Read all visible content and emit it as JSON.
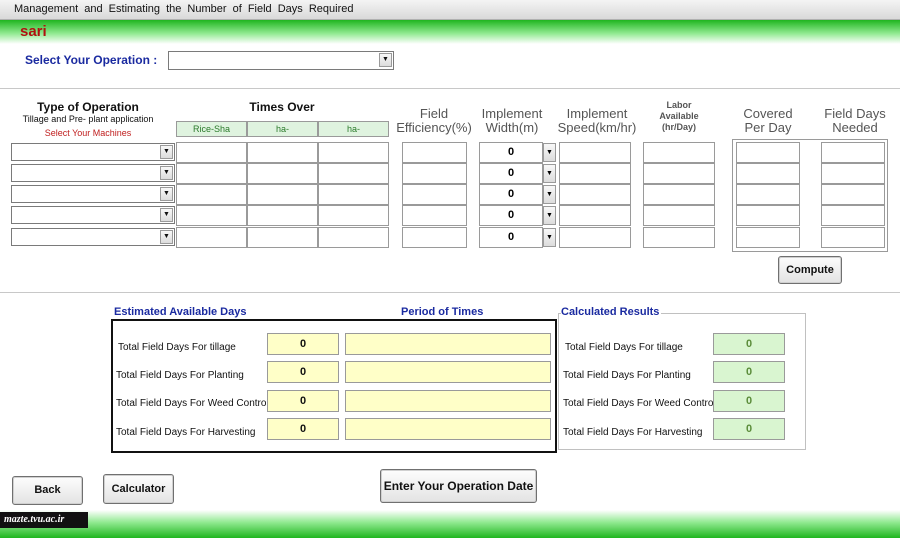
{
  "window": {
    "title": "Management and Estimating the Number of Field Days Required"
  },
  "location": "sari",
  "select_operation": {
    "label": "Select Your Operation :",
    "value": ""
  },
  "table": {
    "type_header": "Type of Operation",
    "type_sub1": "Tillage and Pre- plant application",
    "type_sub2": "Select Your Machines",
    "times_over": "Times Over",
    "times_subheaders": [
      "Rice-Sha",
      "ha-",
      "ha-"
    ],
    "field_eff_line1": "Field",
    "field_eff_line2": "Efficiency(%)",
    "impl_width_line1": "Implement",
    "impl_width_line2": "Width(m)",
    "impl_speed_line1": "Implement",
    "impl_speed_line2": "Speed(km/hr)",
    "labor_line1": "Labor",
    "labor_line2": "Available",
    "labor_line3": "(hr/Day)",
    "covered_line1": "Covered",
    "covered_line2": "Per Day",
    "needed_line1": "Field Days",
    "needed_line2": "Needed",
    "width_values": [
      "0",
      "0",
      "0",
      "0",
      "0"
    ]
  },
  "compute_label": "Compute",
  "estimated": {
    "title": "Estimated Available Days",
    "period_title": "Period  of  Times",
    "rows": [
      {
        "label": "Total Field Days For tillage",
        "value": "0"
      },
      {
        "label": "Total Field Days For Planting",
        "value": "0"
      },
      {
        "label": "Total Field Days For Weed Control",
        "value": "0"
      },
      {
        "label": "Total Field Days For Harvesting",
        "value": "0"
      }
    ]
  },
  "calculated": {
    "title": "Calculated Results",
    "rows": [
      {
        "label": "Total Field Days For tillage",
        "value": "0"
      },
      {
        "label": "Total Field Days For Planting",
        "value": "0"
      },
      {
        "label": "Total Field Days For Weed Control",
        "value": "0"
      },
      {
        "label": "Total Field Days For Harvesting",
        "value": "0"
      }
    ]
  },
  "buttons": {
    "back": "Back",
    "calculator": "Calculator",
    "enter_date": "Enter Your Operation Date"
  },
  "watermark": "mazte.tvu.ac.ir",
  "colors": {
    "accent_green": "#1fb51f",
    "title_blue": "#1a2aa0",
    "location_red": "#b01010",
    "input_yellow": "#ffffc8",
    "result_green": "#d9f5d0"
  }
}
